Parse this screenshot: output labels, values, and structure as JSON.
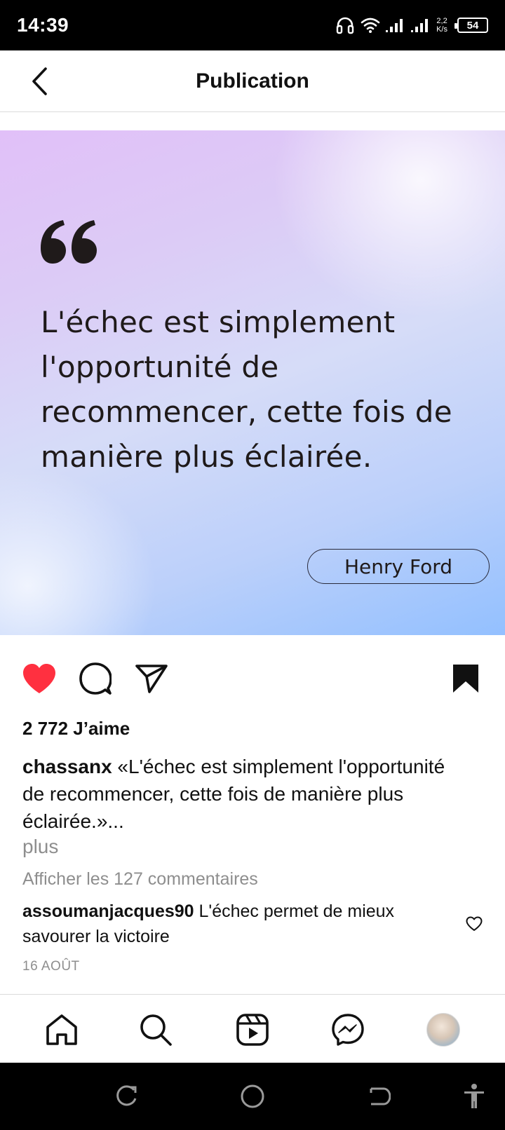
{
  "status_bar": {
    "time": "14:39",
    "net_speed_value": "2,2",
    "net_speed_unit": "K/s",
    "battery": "54",
    "icons": [
      "headphones-icon",
      "wifi-icon",
      "signal-icon",
      "signal-icon-2"
    ]
  },
  "header": {
    "title": "Publication",
    "back_icon": "chevron-left-icon"
  },
  "post_image": {
    "quote_text": "L'échec est simplement l'opportunité de recommencer, cette fois de manière plus éclairée.",
    "author": "Henry Ford",
    "gradient_colors": [
      "#e1c0f8",
      "#d6dcf8",
      "#93c0ff"
    ]
  },
  "actions": {
    "like_icon": "heart-filled-icon",
    "liked": true,
    "like_color": "#ff3040",
    "comment_icon": "comment-icon",
    "share_icon": "send-icon",
    "save_icon": "bookmark-filled-icon"
  },
  "likes": "2 772 J’aime",
  "caption": {
    "username": "chassanx",
    "text": "«L'échec est simplement l'opportunité de recommencer, cette fois de manière plus éclairée.»...",
    "more": "plus"
  },
  "view_comments": "Afficher les 127 commentaires",
  "top_comment": {
    "username": "assoumanjacques90",
    "text": "L'échec permet de mieux savourer la victoire"
  },
  "date": "16 AOÛT",
  "bottom_nav": [
    "home-icon",
    "search-icon",
    "reels-icon",
    "messenger-icon",
    "profile-avatar"
  ],
  "system_nav": [
    "recents-icon",
    "home-circle-icon",
    "back-icon",
    "accessibility-icon"
  ]
}
